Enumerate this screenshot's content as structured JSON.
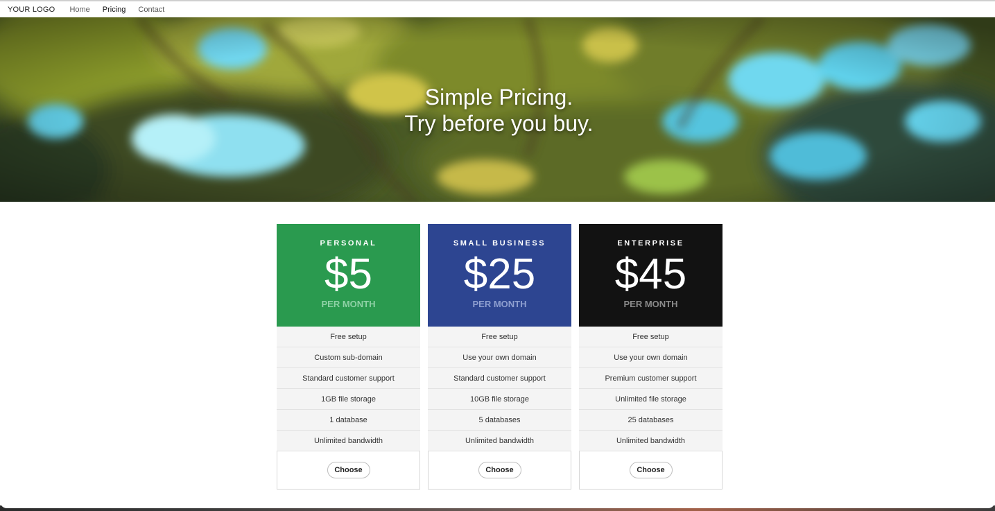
{
  "nav": {
    "logo": "YOUR LOGO",
    "links": [
      {
        "label": "Home",
        "active": false
      },
      {
        "label": "Pricing",
        "active": true
      },
      {
        "label": "Contact",
        "active": false
      }
    ]
  },
  "hero": {
    "line1": "Simple Pricing.",
    "line2": "Try before you buy."
  },
  "plans": [
    {
      "name": "PERSONAL",
      "price": "$5",
      "period": "PER MONTH",
      "color": "#2a9a4f",
      "period_color": "#8fd1a6",
      "features": [
        "Free setup",
        "Custom sub-domain",
        "Standard customer support",
        "1GB file storage",
        "1 database",
        "Unlimited bandwidth"
      ],
      "button": "Choose"
    },
    {
      "name": "SMALL BUSINESS",
      "price": "$25",
      "period": "PER MONTH",
      "color": "#2d4591",
      "period_color": "#8e9fd0",
      "features": [
        "Free setup",
        "Use your own domain",
        "Standard customer support",
        "10GB file storage",
        "5 databases",
        "Unlimited bandwidth"
      ],
      "button": "Choose"
    },
    {
      "name": "ENTERPRISE",
      "price": "$45",
      "period": "PER MONTH",
      "color": "#121212",
      "period_color": "#8a8a8a",
      "features": [
        "Free setup",
        "Use your own domain",
        "Premium customer support",
        "Unlimited file storage",
        "25 databases",
        "Unlimited bandwidth"
      ],
      "button": "Choose"
    }
  ]
}
